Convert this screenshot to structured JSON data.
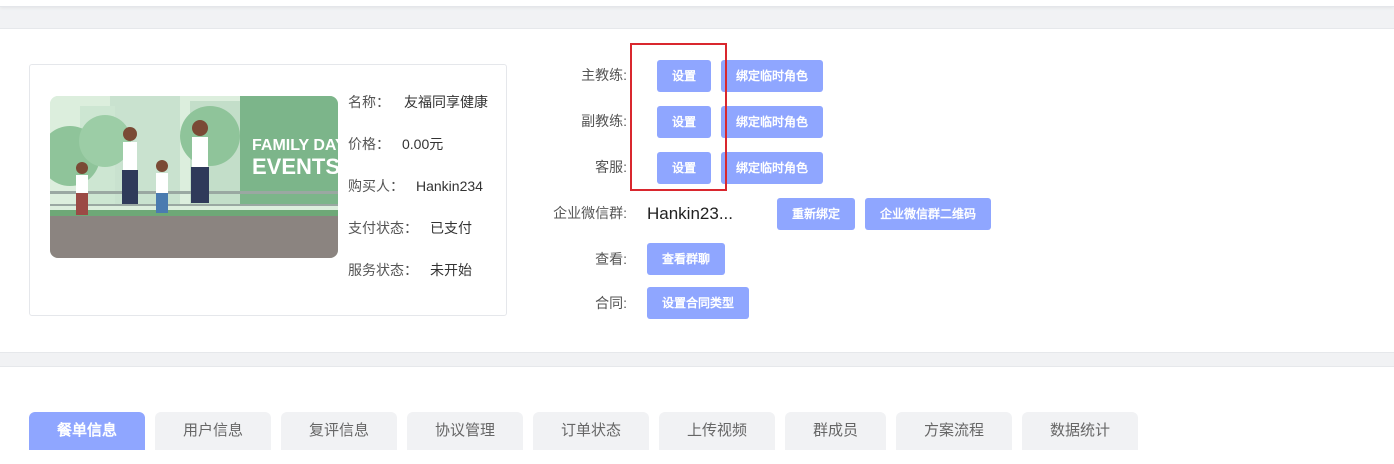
{
  "product": {
    "image_text": "FAMILY DAY EVENTS",
    "name_label": "名称：",
    "name_value": "友福同享健康",
    "price_label": "价格：",
    "price_value": "0.00元",
    "buyer_label": "购买人：",
    "buyer_value": "Hankin234",
    "pay_status_label": "支付状态：",
    "pay_status_value": "已支付",
    "service_status_label": "服务状态：",
    "service_status_value": "未开始"
  },
  "assign": {
    "head_coach_label": "主教练:",
    "assistant_coach_label": "副教练:",
    "support_label": "客服:",
    "set_label": "设置",
    "bind_temp_role_label": "绑定临时角色",
    "wechat_group_label": "企业微信群:",
    "wechat_group_value": "Hankin23...",
    "rebind_label": "重新绑定",
    "group_qr_label": "企业微信群二维码",
    "view_label": "查看:",
    "view_group_chat_label": "查看群聊",
    "contract_label": "合同:",
    "set_contract_type_label": "设置合同类型"
  },
  "tabs": [
    {
      "label": "餐单信息",
      "active": true
    },
    {
      "label": "用户信息",
      "active": false
    },
    {
      "label": "复评信息",
      "active": false
    },
    {
      "label": "协议管理",
      "active": false
    },
    {
      "label": "订单状态",
      "active": false
    },
    {
      "label": "上传视频",
      "active": false
    },
    {
      "label": "群成员",
      "active": false
    },
    {
      "label": "方案流程",
      "active": false
    },
    {
      "label": "数据统计",
      "active": false
    }
  ],
  "colors": {
    "accent": "#8fa6ff",
    "highlight": "#d9272e",
    "tab_inactive": "#f1f2f4"
  }
}
